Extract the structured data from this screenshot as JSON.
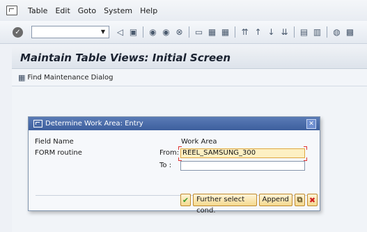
{
  "menu": {
    "items": [
      {
        "label": "Table"
      },
      {
        "label": "Edit"
      },
      {
        "label": "Goto"
      },
      {
        "label": "System"
      },
      {
        "label": "Help"
      }
    ]
  },
  "screen": {
    "title": "Maintain Table Views: Initial Screen",
    "app_toolbar": {
      "find_label": "Find Maintenance Dialog"
    }
  },
  "dialog": {
    "title": "Determine Work Area: Entry",
    "header_field_name": "Field Name",
    "header_work_area": "Work Area",
    "row_label": "FORM routine",
    "from_label": "From:",
    "to_label": "To :",
    "from_value": "REEL_SAMSUNG_300",
    "to_value": "",
    "buttons": {
      "further_select": "Further select cond.",
      "append": "Append"
    }
  },
  "colors": {
    "dialog_title_bar": "#3d5f9d",
    "active_field": "#fdf0c3",
    "button_fill": "#f4d98f",
    "confirm_green": "#3a9a2a",
    "cancel_red": "#d02020"
  }
}
